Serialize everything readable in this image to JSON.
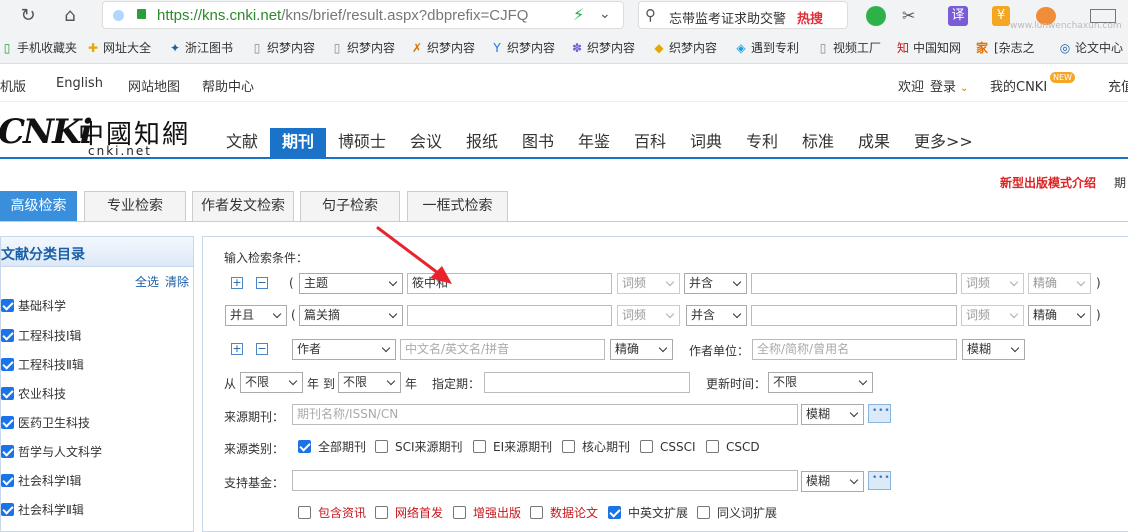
{
  "browser": {
    "url_host": "https://kns.cnki.net",
    "url_path": "/kns/brief/result.aspx?dbprefix=CJFQ",
    "search_text": "忘带监考证求助交警",
    "search_hot": "热搜",
    "translate_label": "译",
    "watermark": "www.lunwenchaxun.com"
  },
  "bookmarks": [
    "手机收藏夹",
    "网址大全",
    "浙江图书",
    "织梦内容",
    "织梦内容",
    "织梦内容",
    "织梦内容",
    "织梦内容",
    "织梦内容",
    "遇到专利",
    "视频工厂",
    "中国知网",
    "家",
    "[杂志之",
    "论文中心"
  ],
  "topbar": {
    "mobile": "机版",
    "english": "English",
    "sitemap": "网站地图",
    "help": "帮助中心",
    "welcome": "欢迎",
    "login": "登录",
    "mycnki": "我的CNKI",
    "new_badge": "NEW",
    "recharge": "充值"
  },
  "logo": {
    "big": "CNKi",
    "cn": "中國知網",
    "en": "cnki.net"
  },
  "nav": [
    "文献",
    "期刊",
    "博硕士",
    "会议",
    "报纸",
    "图书",
    "年鉴",
    "百科",
    "词典",
    "专利",
    "标准",
    "成果",
    "更多>>"
  ],
  "promo": {
    "text": "新型出版模式介绍",
    "trail": "期"
  },
  "search_tabs": [
    "高级检索",
    "专业检索",
    "作者发文检索",
    "句子检索",
    "一框式检索"
  ],
  "sidebar": {
    "title": "文献分类目录",
    "select_all": "全选",
    "clear": "清除",
    "items": [
      "基础科学",
      "工程科技Ⅰ辑",
      "工程科技Ⅱ辑",
      "农业科技",
      "医药卫生科技",
      "哲学与人文科学",
      "社会科学Ⅰ辑",
      "社会科学Ⅱ辑"
    ]
  },
  "form": {
    "title": "输入检索条件：",
    "row1": {
      "field": "主题",
      "value": "筱中和",
      "freq": "词频",
      "logic": "并含",
      "freq2": "词频",
      "match": "精确"
    },
    "row2": {
      "op": "并且",
      "field": "篇关摘",
      "freq": "词频",
      "logic": "并含",
      "freq2": "词频",
      "match": "精确"
    },
    "row3": {
      "field": "作者",
      "placeholder": "中文名/英文名/拼音",
      "match": "精确",
      "unit_label": "作者单位：",
      "unit_placeholder": "全称/简称/曾用名",
      "unit_match": "模糊"
    },
    "row4": {
      "from": "从",
      "year_from": "不限",
      "year": "年",
      "to": "到",
      "year_to": "不限",
      "year2": "年",
      "period_label": "指定期：",
      "update_label": "更新时间：",
      "update": "不限"
    },
    "source": {
      "label": "来源期刊：",
      "placeholder": "期刊名称/ISSN/CN",
      "match": "模糊"
    },
    "category": {
      "label": "来源类别：",
      "options": [
        "全部期刊",
        "SCI来源期刊",
        "EI来源期刊",
        "核心期刊",
        "CSSCI",
        "CSCD"
      ]
    },
    "fund": {
      "label": "支持基金：",
      "match": "模糊"
    },
    "extras": [
      "包含资讯",
      "网络首发",
      "增强出版",
      "数据论文",
      "中英文扩展",
      "同义词扩展"
    ]
  }
}
